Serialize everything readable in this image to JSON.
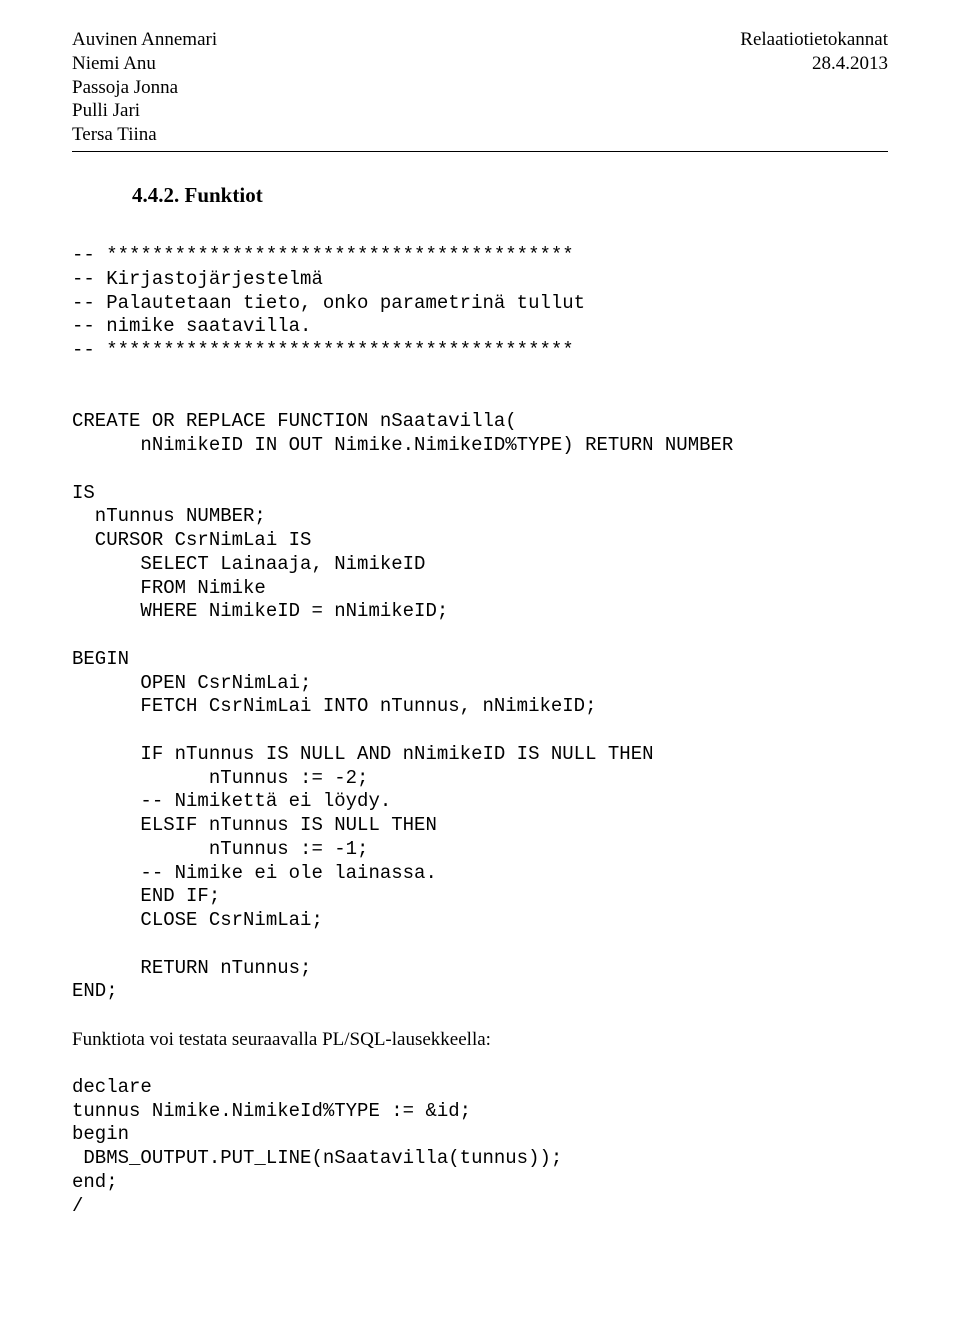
{
  "header": {
    "authors": [
      "Auvinen Annemari",
      "Niemi Anu",
      "Passoja Jonna",
      "Pulli Jari",
      "Tersa Tiina"
    ],
    "course": "Relaatiotietokannat",
    "date": "28.4.2013"
  },
  "section": {
    "number": "4.4.2.",
    "title": "Funktiot"
  },
  "code_block_1": "-- *****************************************\n-- Kirjastojärjestelmä\n-- Palautetaan tieto, onko parametrinä tullut\n-- nimike saatavilla.\n-- *****************************************\n\n\nCREATE OR REPLACE FUNCTION nSaatavilla(\n      nNimikeID IN OUT Nimike.NimikeID%TYPE) RETURN NUMBER\n\nIS\n  nTunnus NUMBER;\n  CURSOR CsrNimLai IS\n      SELECT Lainaaja, NimikeID\n      FROM Nimike\n      WHERE NimikeID = nNimikeID;\n\nBEGIN\n      OPEN CsrNimLai;\n      FETCH CsrNimLai INTO nTunnus, nNimikeID;\n\n      IF nTunnus IS NULL AND nNimikeID IS NULL THEN\n            nTunnus := -2;\n      -- Nimikettä ei löydy.\n      ELSIF nTunnus IS NULL THEN\n            nTunnus := -1;\n      -- Nimike ei ole lainassa.\n      END IF;\n      CLOSE CsrNimLai;\n\n      RETURN nTunnus;\nEND;",
  "caption": "Funktiota voi testata seuraavalla PL/SQL-lausekkeella:",
  "code_block_2": "declare\ntunnus Nimike.NimikeId%TYPE := &id;\nbegin\n DBMS_OUTPUT.PUT_LINE(nSaatavilla(tunnus));\nend;\n/"
}
